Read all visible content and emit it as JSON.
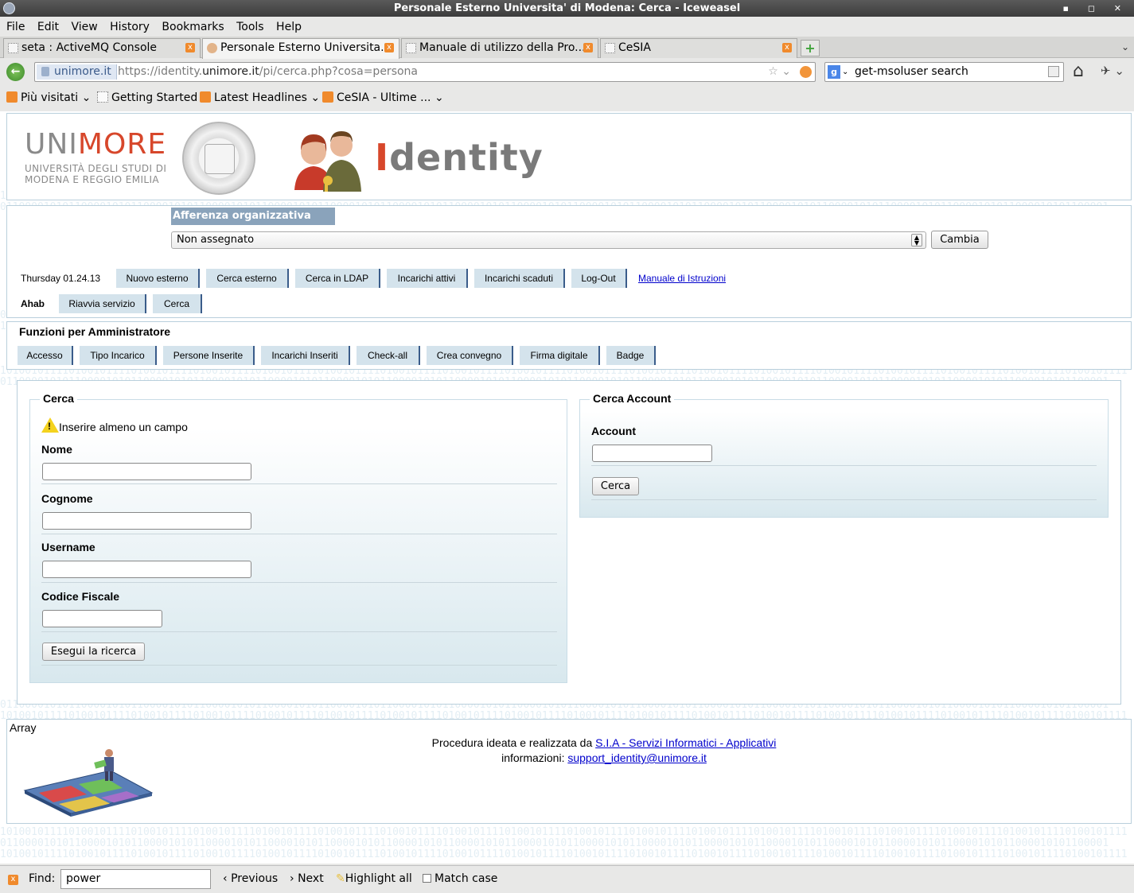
{
  "window": {
    "title": "Personale Esterno Universita' di Modena: Cerca - Iceweasel"
  },
  "menu": [
    "File",
    "Edit",
    "View",
    "History",
    "Bookmarks",
    "Tools",
    "Help"
  ],
  "tabs": [
    {
      "label": "seta : ActiveMQ Console"
    },
    {
      "label": "Personale Esterno Universita..."
    },
    {
      "label": "Manuale di utilizzo della Pro..."
    },
    {
      "label": "CeSIA"
    }
  ],
  "nav": {
    "site_identity": "unimore.it",
    "url_prefix": "https://identity.",
    "url_domain": "unimore.it",
    "url_path": "/pi/cerca.php?cosa=persona",
    "search_text": "get-msoluser search",
    "search_engine_icon": "google-icon"
  },
  "bookmarks": [
    {
      "label": "Più visitati",
      "icon": "rss"
    },
    {
      "label": "Getting Started",
      "icon": "blank"
    },
    {
      "label": "Latest Headlines",
      "icon": "rss"
    },
    {
      "label": "CeSIA  - Ultime ...",
      "icon": "rss"
    }
  ],
  "header": {
    "logo_uni": "UNI",
    "logo_more": "MORE",
    "logo_sub_1": "UNIVERSITÀ DEGLI STUDI DI",
    "logo_sub_2": "MODENA E REGGIO EMILIA",
    "app_name_initial": "I",
    "app_name_rest": "dentity"
  },
  "affiliation": {
    "title": "Afferenza organizzativa",
    "selected": "Non assegnato",
    "button": "Cambia"
  },
  "toolbar": {
    "date": "Thursday 01.24.13",
    "buttons": [
      "Nuovo esterno",
      "Cerca esterno",
      "Cerca in LDAP",
      "Incarichi attivi",
      "Incarichi scaduti",
      "Log-Out"
    ],
    "manual_link": "Manuale di Istruzioni",
    "user": "Ahab",
    "user_buttons": [
      "Riavvia servizio",
      "Cerca"
    ]
  },
  "admin": {
    "title": "Funzioni per Amministratore",
    "buttons": [
      "Accesso",
      "Tipo Incarico",
      "Persone Inserite",
      "Incarichi Inseriti",
      "Check-all",
      "Crea convegno",
      "Firma digitale",
      "Badge"
    ]
  },
  "search_form": {
    "legend": "Cerca",
    "warning": "Inserire almeno un campo",
    "fields": [
      {
        "label": "Nome",
        "value": ""
      },
      {
        "label": "Cognome",
        "value": ""
      },
      {
        "label": "Username",
        "value": ""
      },
      {
        "label": "Codice Fiscale",
        "value": ""
      }
    ],
    "submit": "Esegui la ricerca"
  },
  "account_form": {
    "legend": "Cerca Account",
    "field_label": "Account",
    "value": "",
    "submit": "Cerca"
  },
  "footer": {
    "debug": "Array",
    "credit_prefix": "Procedura ideata e realizzata da",
    "credit_link": "S.I.A - Servizi Informatici - Applicativi",
    "info_prefix": "informazioni:",
    "info_email": "support_identity@unimore.it"
  },
  "findbar": {
    "label": "Find:",
    "value": "power",
    "previous": "Previous",
    "next": "Next",
    "highlight": "Highlight all",
    "match_case": "Match case"
  },
  "colors": {
    "accent_red": "#d7472b",
    "tab_bg": "#d4e3ec",
    "tab_border": "#3a5c8a",
    "link": "#0000cc"
  }
}
